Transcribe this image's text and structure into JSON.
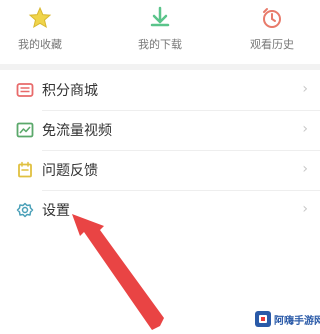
{
  "top_bar": {
    "items": [
      {
        "label": "我的收藏",
        "icon": "star-icon",
        "color": "#f0d44a"
      },
      {
        "label": "我的下载",
        "icon": "download-icon",
        "color": "#5ac48a"
      },
      {
        "label": "观看历史",
        "icon": "history-icon",
        "color": "#e87a6a"
      }
    ]
  },
  "menu": {
    "items": [
      {
        "label": "积分商城",
        "icon": "points-store-icon",
        "color": "#e86a6a"
      },
      {
        "label": "免流量视频",
        "icon": "free-data-video-icon",
        "color": "#5aa86a"
      },
      {
        "label": "问题反馈",
        "icon": "feedback-icon",
        "color": "#e0c040"
      },
      {
        "label": "设置",
        "icon": "settings-gear-icon",
        "color": "#4aa0b8"
      }
    ],
    "chevron": "›"
  },
  "annotation": {
    "arrow_color": "#e83a3a"
  },
  "watermark": {
    "text": "阿嗨手游网"
  }
}
